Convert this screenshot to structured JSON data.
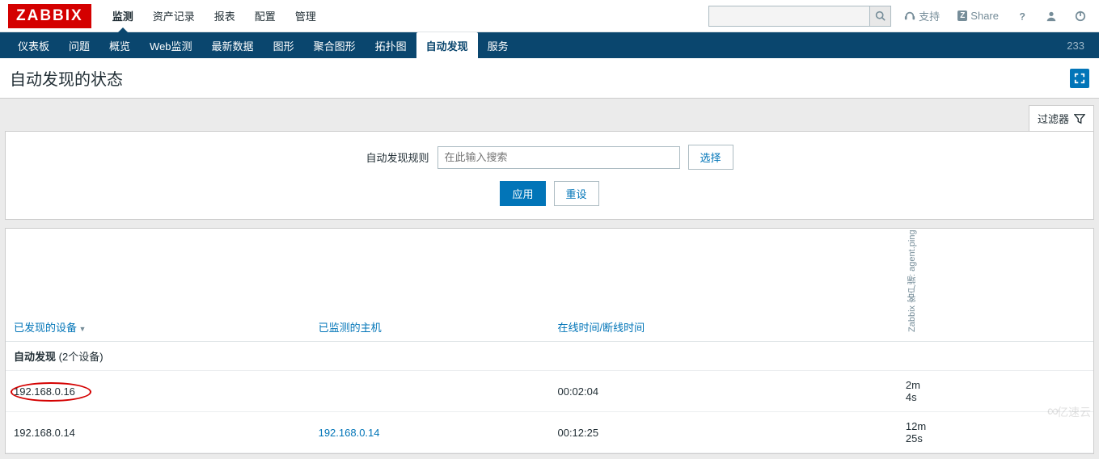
{
  "logo": "ZABBIX",
  "top_menu": [
    "监测",
    "资产记录",
    "报表",
    "配置",
    "管理"
  ],
  "top_menu_active": 0,
  "support_label": "支持",
  "share_label": "Share",
  "sub_menu": [
    "仪表板",
    "问题",
    "概览",
    "Web监测",
    "最新数据",
    "图形",
    "聚合图形",
    "拓扑图",
    "自动发现",
    "服务"
  ],
  "sub_menu_active": 8,
  "sub_right_count": "233",
  "page_title": "自动发现的状态",
  "filter_tab_label": "过滤器",
  "filter": {
    "rule_label": "自动发现规则",
    "input_placeholder": "在此输入搜索",
    "select_btn": "选择",
    "apply_btn": "应用",
    "reset_btn": "重设"
  },
  "columns": {
    "discovered": "已发现的设备",
    "monitored": "已监测的主机",
    "uptime": "在线时间/断线时间",
    "vertical": "Zabbix 客户端: agent.ping"
  },
  "group_label": "自动发现",
  "group_count": "(2个设备)",
  "rows": [
    {
      "ip": "192.168.0.16",
      "host": "",
      "uptime": "00:02:04",
      "ping": "2m 4s",
      "circled": true
    },
    {
      "ip": "192.168.0.14",
      "host": "192.168.0.14",
      "uptime": "00:12:25",
      "ping": "12m 25s",
      "circled": false
    }
  ],
  "watermark": "亿速云"
}
